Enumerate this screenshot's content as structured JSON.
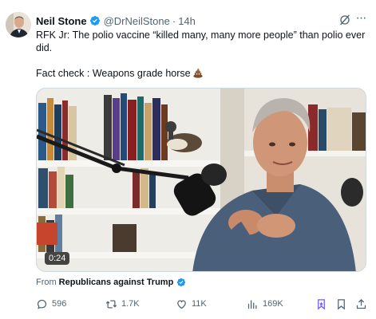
{
  "tweet": {
    "author_name": "Neil Stone",
    "handle": "@DrNeilStone",
    "separator": "·",
    "time": "14h",
    "text_line1": "RFK Jr:  The polio vaccine “killed many, many more people” than polio ever did.",
    "text_line2": "Fact check : Weapons grade horse",
    "media": {
      "duration": "0:24"
    },
    "from_label": "From",
    "from_source": "Republicans against Trump",
    "actions": {
      "replies": "596",
      "reposts": "1.7K",
      "likes": "11K",
      "views": "169K"
    }
  },
  "colors": {
    "verified": "#1d9bf0",
    "secondary_text": "#536471",
    "grok_icon": "#536471",
    "bookmark_accent": "#7856ff"
  },
  "icons": [
    "verified-badge-icon",
    "grok-icon",
    "more-icon",
    "poop-emoji",
    "reply-icon",
    "repost-icon",
    "like-icon",
    "views-icon",
    "grok-bookmark-icon",
    "bookmark-icon",
    "share-icon"
  ]
}
